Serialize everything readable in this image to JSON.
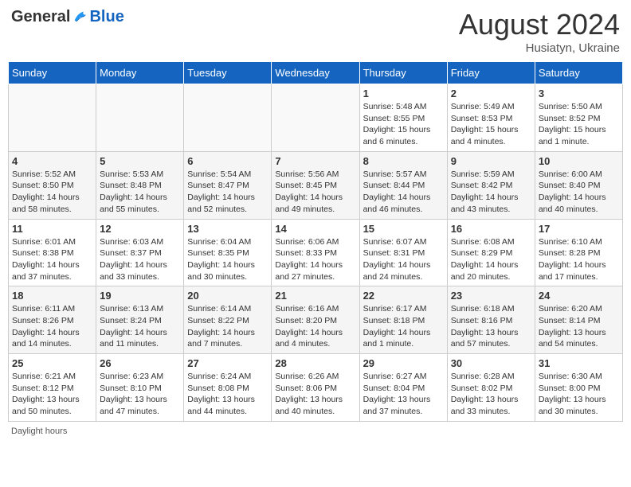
{
  "header": {
    "logo_general": "General",
    "logo_blue": "Blue",
    "month_title": "August 2024",
    "subtitle": "Husiatyn, Ukraine"
  },
  "days_of_week": [
    "Sunday",
    "Monday",
    "Tuesday",
    "Wednesday",
    "Thursday",
    "Friday",
    "Saturday"
  ],
  "weeks": [
    [
      {
        "day": "",
        "info": ""
      },
      {
        "day": "",
        "info": ""
      },
      {
        "day": "",
        "info": ""
      },
      {
        "day": "",
        "info": ""
      },
      {
        "day": "1",
        "info": "Sunrise: 5:48 AM\nSunset: 8:55 PM\nDaylight: 15 hours and 6 minutes."
      },
      {
        "day": "2",
        "info": "Sunrise: 5:49 AM\nSunset: 8:53 PM\nDaylight: 15 hours and 4 minutes."
      },
      {
        "day": "3",
        "info": "Sunrise: 5:50 AM\nSunset: 8:52 PM\nDaylight: 15 hours and 1 minute."
      }
    ],
    [
      {
        "day": "4",
        "info": "Sunrise: 5:52 AM\nSunset: 8:50 PM\nDaylight: 14 hours and 58 minutes."
      },
      {
        "day": "5",
        "info": "Sunrise: 5:53 AM\nSunset: 8:48 PM\nDaylight: 14 hours and 55 minutes."
      },
      {
        "day": "6",
        "info": "Sunrise: 5:54 AM\nSunset: 8:47 PM\nDaylight: 14 hours and 52 minutes."
      },
      {
        "day": "7",
        "info": "Sunrise: 5:56 AM\nSunset: 8:45 PM\nDaylight: 14 hours and 49 minutes."
      },
      {
        "day": "8",
        "info": "Sunrise: 5:57 AM\nSunset: 8:44 PM\nDaylight: 14 hours and 46 minutes."
      },
      {
        "day": "9",
        "info": "Sunrise: 5:59 AM\nSunset: 8:42 PM\nDaylight: 14 hours and 43 minutes."
      },
      {
        "day": "10",
        "info": "Sunrise: 6:00 AM\nSunset: 8:40 PM\nDaylight: 14 hours and 40 minutes."
      }
    ],
    [
      {
        "day": "11",
        "info": "Sunrise: 6:01 AM\nSunset: 8:38 PM\nDaylight: 14 hours and 37 minutes."
      },
      {
        "day": "12",
        "info": "Sunrise: 6:03 AM\nSunset: 8:37 PM\nDaylight: 14 hours and 33 minutes."
      },
      {
        "day": "13",
        "info": "Sunrise: 6:04 AM\nSunset: 8:35 PM\nDaylight: 14 hours and 30 minutes."
      },
      {
        "day": "14",
        "info": "Sunrise: 6:06 AM\nSunset: 8:33 PM\nDaylight: 14 hours and 27 minutes."
      },
      {
        "day": "15",
        "info": "Sunrise: 6:07 AM\nSunset: 8:31 PM\nDaylight: 14 hours and 24 minutes."
      },
      {
        "day": "16",
        "info": "Sunrise: 6:08 AM\nSunset: 8:29 PM\nDaylight: 14 hours and 20 minutes."
      },
      {
        "day": "17",
        "info": "Sunrise: 6:10 AM\nSunset: 8:28 PM\nDaylight: 14 hours and 17 minutes."
      }
    ],
    [
      {
        "day": "18",
        "info": "Sunrise: 6:11 AM\nSunset: 8:26 PM\nDaylight: 14 hours and 14 minutes."
      },
      {
        "day": "19",
        "info": "Sunrise: 6:13 AM\nSunset: 8:24 PM\nDaylight: 14 hours and 11 minutes."
      },
      {
        "day": "20",
        "info": "Sunrise: 6:14 AM\nSunset: 8:22 PM\nDaylight: 14 hours and 7 minutes."
      },
      {
        "day": "21",
        "info": "Sunrise: 6:16 AM\nSunset: 8:20 PM\nDaylight: 14 hours and 4 minutes."
      },
      {
        "day": "22",
        "info": "Sunrise: 6:17 AM\nSunset: 8:18 PM\nDaylight: 14 hours and 1 minute."
      },
      {
        "day": "23",
        "info": "Sunrise: 6:18 AM\nSunset: 8:16 PM\nDaylight: 13 hours and 57 minutes."
      },
      {
        "day": "24",
        "info": "Sunrise: 6:20 AM\nSunset: 8:14 PM\nDaylight: 13 hours and 54 minutes."
      }
    ],
    [
      {
        "day": "25",
        "info": "Sunrise: 6:21 AM\nSunset: 8:12 PM\nDaylight: 13 hours and 50 minutes."
      },
      {
        "day": "26",
        "info": "Sunrise: 6:23 AM\nSunset: 8:10 PM\nDaylight: 13 hours and 47 minutes."
      },
      {
        "day": "27",
        "info": "Sunrise: 6:24 AM\nSunset: 8:08 PM\nDaylight: 13 hours and 44 minutes."
      },
      {
        "day": "28",
        "info": "Sunrise: 6:26 AM\nSunset: 8:06 PM\nDaylight: 13 hours and 40 minutes."
      },
      {
        "day": "29",
        "info": "Sunrise: 6:27 AM\nSunset: 8:04 PM\nDaylight: 13 hours and 37 minutes."
      },
      {
        "day": "30",
        "info": "Sunrise: 6:28 AM\nSunset: 8:02 PM\nDaylight: 13 hours and 33 minutes."
      },
      {
        "day": "31",
        "info": "Sunrise: 6:30 AM\nSunset: 8:00 PM\nDaylight: 13 hours and 30 minutes."
      }
    ]
  ],
  "footer": {
    "note": "Daylight hours"
  }
}
